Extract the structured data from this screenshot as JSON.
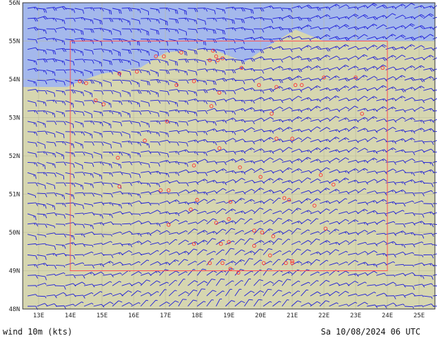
{
  "caption": {
    "left": "wind 10m (kts)",
    "right": "Sa 10/08/2024 06 UTC"
  },
  "map": {
    "lat_labels": [
      "48N",
      "49N",
      "50N",
      "51N",
      "52N",
      "53N",
      "54N",
      "55N",
      "56N"
    ],
    "lon_labels": [
      "13E",
      "14E",
      "15E",
      "16E",
      "17E",
      "18E",
      "19E",
      "20E",
      "21E",
      "22E",
      "23E",
      "24E",
      "25E"
    ],
    "extent": {
      "lon": [
        12.5,
        25.5
      ],
      "lat": [
        48,
        56
      ]
    },
    "domain_box": {
      "lon": [
        14,
        24
      ],
      "lat": [
        49,
        55
      ]
    },
    "colors": {
      "land": "#d6d6b0",
      "sea": "#a4b8ec",
      "barbs": "#1a1ad8",
      "stations": "#ff3030",
      "domain_box": "#ff5050",
      "grid": "#b8b89a"
    },
    "icons": {
      "barb": "wind-barb-icon",
      "station": "station-circle-icon"
    }
  }
}
